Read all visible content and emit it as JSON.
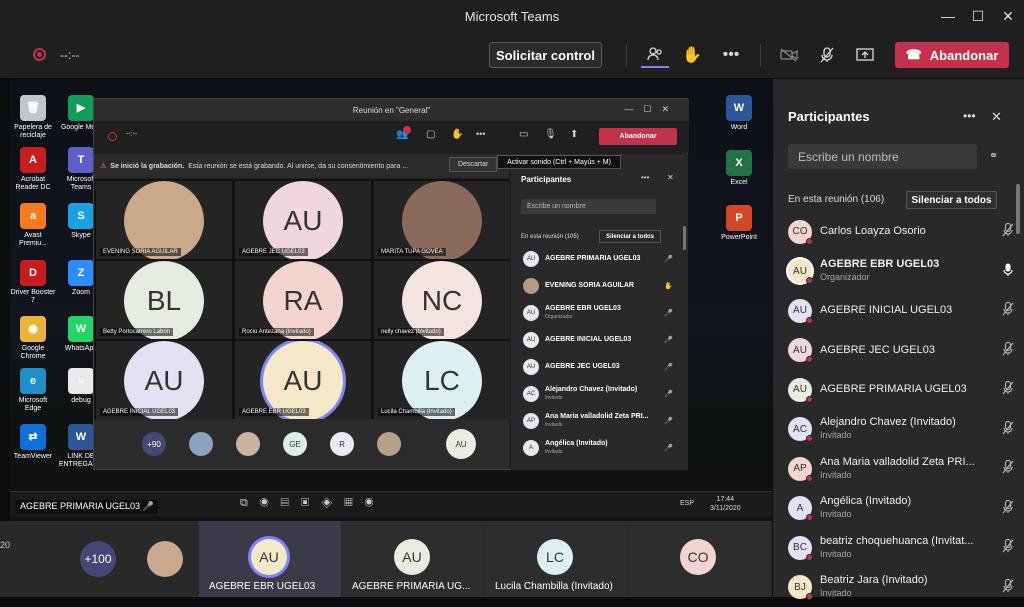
{
  "window": {
    "title": "Microsoft Teams",
    "min": "—",
    "max": "☐",
    "close": "✕"
  },
  "toolbar": {
    "timer": "--:--",
    "request_control": "Solicitar control",
    "leave": "Abandonar"
  },
  "desktop_icons": [
    {
      "label": "Papelera de reciclaje",
      "glyph": "🗑",
      "color": "#c0c6cc"
    },
    {
      "label": "Google Meet",
      "glyph": "▶",
      "color": "#0f9d58"
    },
    {
      "label": "Acrobat Reader DC",
      "glyph": "A",
      "color": "#c71f1f"
    },
    {
      "label": "Microsoft Teams",
      "glyph": "T",
      "color": "#5b5fc7"
    },
    {
      "label": "Avast Premiu...",
      "glyph": "a",
      "color": "#f77a1c"
    },
    {
      "label": "Skype",
      "glyph": "S",
      "color": "#1ba1e2"
    },
    {
      "label": "Driver Booster 7",
      "glyph": "D",
      "color": "#c41e1e"
    },
    {
      "label": "Zoom",
      "glyph": "Z",
      "color": "#2d8cff"
    },
    {
      "label": "Google Chrome",
      "glyph": "◉",
      "color": "#e8b53a"
    },
    {
      "label": "WhatsApp",
      "glyph": "W",
      "color": "#25d366"
    },
    {
      "label": "Microsoft Edge",
      "glyph": "e",
      "color": "#1e90c9"
    },
    {
      "label": "debug",
      "glyph": "≡",
      "color": "#e8e8e8"
    },
    {
      "label": "TeamViewer",
      "glyph": "⇄",
      "color": "#0e6fd8"
    },
    {
      "label": "LINK DE ENTREGAB...",
      "glyph": "W",
      "color": "#2b579a"
    },
    {
      "label": "Word",
      "glyph": "W",
      "color": "#2b579a"
    },
    {
      "label": "Excel",
      "glyph": "X",
      "color": "#217346"
    },
    {
      "label": "PowerPoint",
      "glyph": "P",
      "color": "#d24726"
    }
  ],
  "inner": {
    "title": "Reunión en \"General\"",
    "timer": "--:--",
    "leave": "Abandonar",
    "banner_bold": "Se inició la grabación.",
    "banner_text": "Esta reunión se está grabando. Al unirse, da su consentimiento para ...",
    "banner_dismiss": "Descartar",
    "tooltip": "Activar sonido (Ctrl + Mayús + M)",
    "tiles": [
      {
        "initials": "",
        "name": "EVENING SORIA AGUILAR",
        "photo": true,
        "color": "#c9a98a"
      },
      {
        "initials": "AU",
        "name": "AGEBRE JEC UGEL03",
        "color": "#efd6df"
      },
      {
        "initials": "",
        "name": "MARITA TUPA GOVEA",
        "photo": true,
        "color": "#8a6a5a"
      },
      {
        "initials": "BL",
        "name": "Betty Portocarrero Labrin",
        "color": "#e6ece0"
      },
      {
        "initials": "RA",
        "name": "Rocio Antezana (Invitado)",
        "color": "#f4d4cf"
      },
      {
        "initials": "NC",
        "name": "nelly chavez (Invitado)",
        "color": "#f3e4e0"
      },
      {
        "initials": "AU",
        "name": "AGEBRE INICIAL UGEL03",
        "color": "#e3e1f4"
      },
      {
        "initials": "AU",
        "name": "AGEBRE EBR UGEL03",
        "color": "#f4e8c8"
      },
      {
        "initials": "LC",
        "name": "Lucila Chambilla (Invitado)",
        "color": "#dcf0f2"
      }
    ],
    "strip": [
      {
        "label": "+90",
        "color": "#464775",
        "text": "#fff"
      },
      {
        "label": "",
        "color": "#8aa4c0",
        "text": "#333"
      },
      {
        "label": "",
        "color": "#c9b3a0",
        "text": "#333"
      },
      {
        "label": "GE",
        "color": "#dcefe8",
        "text": "#333"
      },
      {
        "label": "R",
        "color": "#ece8f4",
        "text": "#333"
      },
      {
        "label": "",
        "color": "#b7a08a",
        "text": "#333"
      }
    ],
    "strip_right": "AU",
    "panel": {
      "title": "Participantes",
      "search": "Escribe un nombre",
      "section": "En esta reunión (105)",
      "mute_all": "Silenciar a todos",
      "rows": [
        {
          "initials": "AU",
          "name": "AGEBRE PRIMARIA UGEL03",
          "sub": "",
          "mic": "🎤"
        },
        {
          "initials": "",
          "name": "EVENING SORIA AGUILAR",
          "sub": "",
          "mic": "✋"
        },
        {
          "initials": "AU",
          "name": "AGEBRE EBR UGEL03",
          "sub": "Organizador",
          "mic": "🎤"
        },
        {
          "initials": "AU",
          "name": "AGEBRE INICIAL UGEL03",
          "sub": "",
          "mic": "🎤"
        },
        {
          "initials": "AU",
          "name": "AGEBRE JEC UGEL03",
          "sub": "",
          "mic": "🎤"
        },
        {
          "initials": "AC",
          "name": "Alejandro Chavez (Invitado)",
          "sub": "Invitado",
          "mic": "🎤"
        },
        {
          "initials": "AP",
          "name": "Ana Maria valladolid Zeta PRI...",
          "sub": "Invitado",
          "mic": "🎤"
        },
        {
          "initials": "A",
          "name": "Angélica (Invitado)",
          "sub": "Invitado",
          "mic": "🎤"
        }
      ]
    }
  },
  "taskbar": {
    "left_label": "AGEBRE PRIMARIA UGEL03",
    "lang": "ESP",
    "time": "17:44",
    "date": "3/11/2020"
  },
  "bottom": {
    "count": "+100",
    "tiles": [
      {
        "initials": "AU",
        "name": "AGEBRE EBR UGEL03",
        "color": "#f4e8c8"
      },
      {
        "initials": "AU",
        "name": "AGEBRE PRIMARIA UG...",
        "color": "#e8ede0"
      },
      {
        "initials": "LC",
        "name": "Lucila Chambilla (Invitado)",
        "color": "#dcf0f2"
      },
      {
        "initials": "CO",
        "name": "",
        "color": "#f4d4cf"
      }
    ]
  },
  "panel": {
    "title": "Participantes",
    "search": "Escribe un nombre",
    "section": "En esta reunión (106)",
    "mute_all": "Silenciar a todos",
    "rows": [
      {
        "initials": "CO",
        "name": "Carlos Loayza Osorio",
        "sub": "",
        "color": "#f4d4cf",
        "mic": "muted"
      },
      {
        "initials": "AU",
        "name": "AGEBRE EBR UGEL03",
        "sub": "Organizador",
        "color": "#f4e8c8",
        "mic": "on",
        "bold": true
      },
      {
        "initials": "AU",
        "name": "AGEBRE INICIAL UGEL03",
        "sub": "",
        "color": "#e3e1f4",
        "mic": "muted"
      },
      {
        "initials": "AU",
        "name": "AGEBRE JEC UGEL03",
        "sub": "",
        "color": "#efd6df",
        "mic": "muted"
      },
      {
        "initials": "AU",
        "name": "AGEBRE PRIMARIA UGEL03",
        "sub": "",
        "color": "#e8ede0",
        "mic": "muted"
      },
      {
        "initials": "AC",
        "name": "Alejandro Chavez (Invitado)",
        "sub": "Invitado",
        "color": "#e3e1f4",
        "mic": "muted"
      },
      {
        "initials": "AP",
        "name": "Ana Maria valladolid Zeta PRI...",
        "sub": "Invitado",
        "color": "#f4d4cf",
        "mic": "muted"
      },
      {
        "initials": "A",
        "name": "Angélica (Invitado)",
        "sub": "Invitado",
        "color": "#e3e1f4",
        "mic": "muted"
      },
      {
        "initials": "BC",
        "name": "beatriz choquehuanca (Invitat...",
        "sub": "Invitado",
        "color": "#e3e1f4",
        "mic": "muted"
      },
      {
        "initials": "BJ",
        "name": "Beatriz Jara (Invitado)",
        "sub": "Invitado",
        "color": "#f4e8c8",
        "mic": "muted"
      }
    ]
  }
}
